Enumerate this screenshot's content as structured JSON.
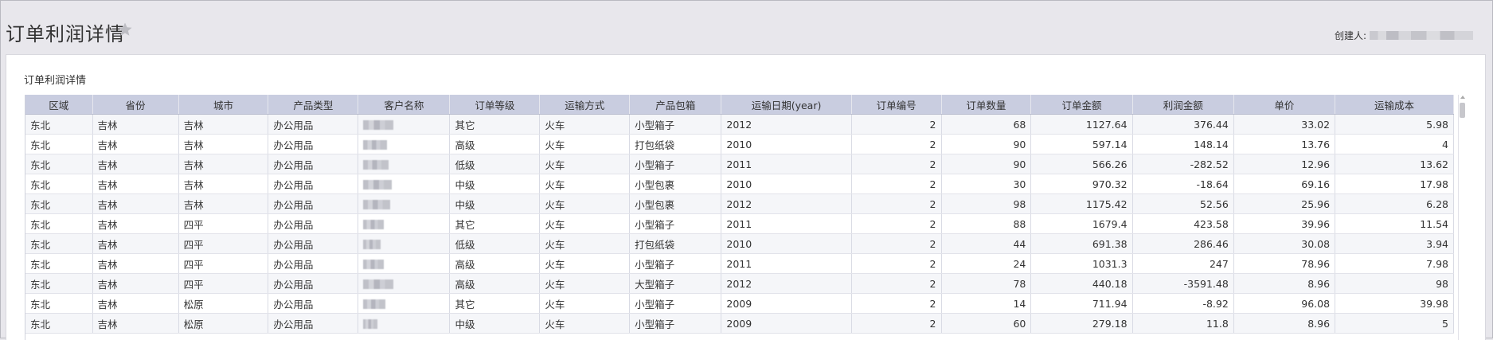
{
  "page": {
    "title": "订单利润详情",
    "creator_label": "创建人:"
  },
  "panel": {
    "title": "订单利润详情"
  },
  "table": {
    "columns": [
      "区域",
      "省份",
      "城市",
      "产品类型",
      "客户名称",
      "订单等级",
      "运输方式",
      "产品包箱",
      "运输日期(year)",
      "订单编号",
      "订单数量",
      "订单金额",
      "利润金额",
      "单价",
      "运输成本"
    ],
    "rows": [
      [
        "东北",
        "吉林",
        "吉林",
        "办公用品",
        "",
        "其它",
        "火车",
        "小型箱子",
        "2012",
        "2",
        "68",
        "1127.64",
        "376.44",
        "33.02",
        "5.98"
      ],
      [
        "东北",
        "吉林",
        "吉林",
        "办公用品",
        "",
        "高级",
        "火车",
        "打包纸袋",
        "2010",
        "2",
        "90",
        "597.14",
        "148.14",
        "13.76",
        "4"
      ],
      [
        "东北",
        "吉林",
        "吉林",
        "办公用品",
        "",
        "低级",
        "火车",
        "小型箱子",
        "2011",
        "2",
        "90",
        "566.26",
        "-282.52",
        "12.96",
        "13.62"
      ],
      [
        "东北",
        "吉林",
        "吉林",
        "办公用品",
        "",
        "中级",
        "火车",
        "小型包裹",
        "2010",
        "2",
        "30",
        "970.32",
        "-18.64",
        "69.16",
        "17.98"
      ],
      [
        "东北",
        "吉林",
        "吉林",
        "办公用品",
        "",
        "中级",
        "火车",
        "小型包裹",
        "2012",
        "2",
        "98",
        "1175.42",
        "52.56",
        "25.96",
        "6.28"
      ],
      [
        "东北",
        "吉林",
        "四平",
        "办公用品",
        "",
        "其它",
        "火车",
        "小型箱子",
        "2011",
        "2",
        "88",
        "1679.4",
        "423.58",
        "39.96",
        "11.54"
      ],
      [
        "东北",
        "吉林",
        "四平",
        "办公用品",
        "",
        "低级",
        "火车",
        "打包纸袋",
        "2010",
        "2",
        "44",
        "691.38",
        "286.46",
        "30.08",
        "3.94"
      ],
      [
        "东北",
        "吉林",
        "四平",
        "办公用品",
        "",
        "高级",
        "火车",
        "小型箱子",
        "2011",
        "2",
        "24",
        "1031.3",
        "247",
        "78.96",
        "7.98"
      ],
      [
        "东北",
        "吉林",
        "四平",
        "办公用品",
        "",
        "高级",
        "火车",
        "大型箱子",
        "2012",
        "2",
        "78",
        "440.18",
        "-3591.48",
        "8.96",
        "98"
      ],
      [
        "东北",
        "吉林",
        "松原",
        "办公用品",
        "",
        "其它",
        "火车",
        "小型箱子",
        "2009",
        "2",
        "14",
        "711.94",
        "-8.92",
        "96.08",
        "39.98"
      ],
      [
        "东北",
        "吉林",
        "松原",
        "办公用品",
        "",
        "中级",
        "火车",
        "小型箱子",
        "2009",
        "2",
        "60",
        "279.18",
        "11.8",
        "8.96",
        "5"
      ]
    ],
    "numeric_columns": [
      9,
      10,
      11,
      12,
      13,
      14
    ]
  },
  "icons": {
    "star": "star-icon"
  }
}
